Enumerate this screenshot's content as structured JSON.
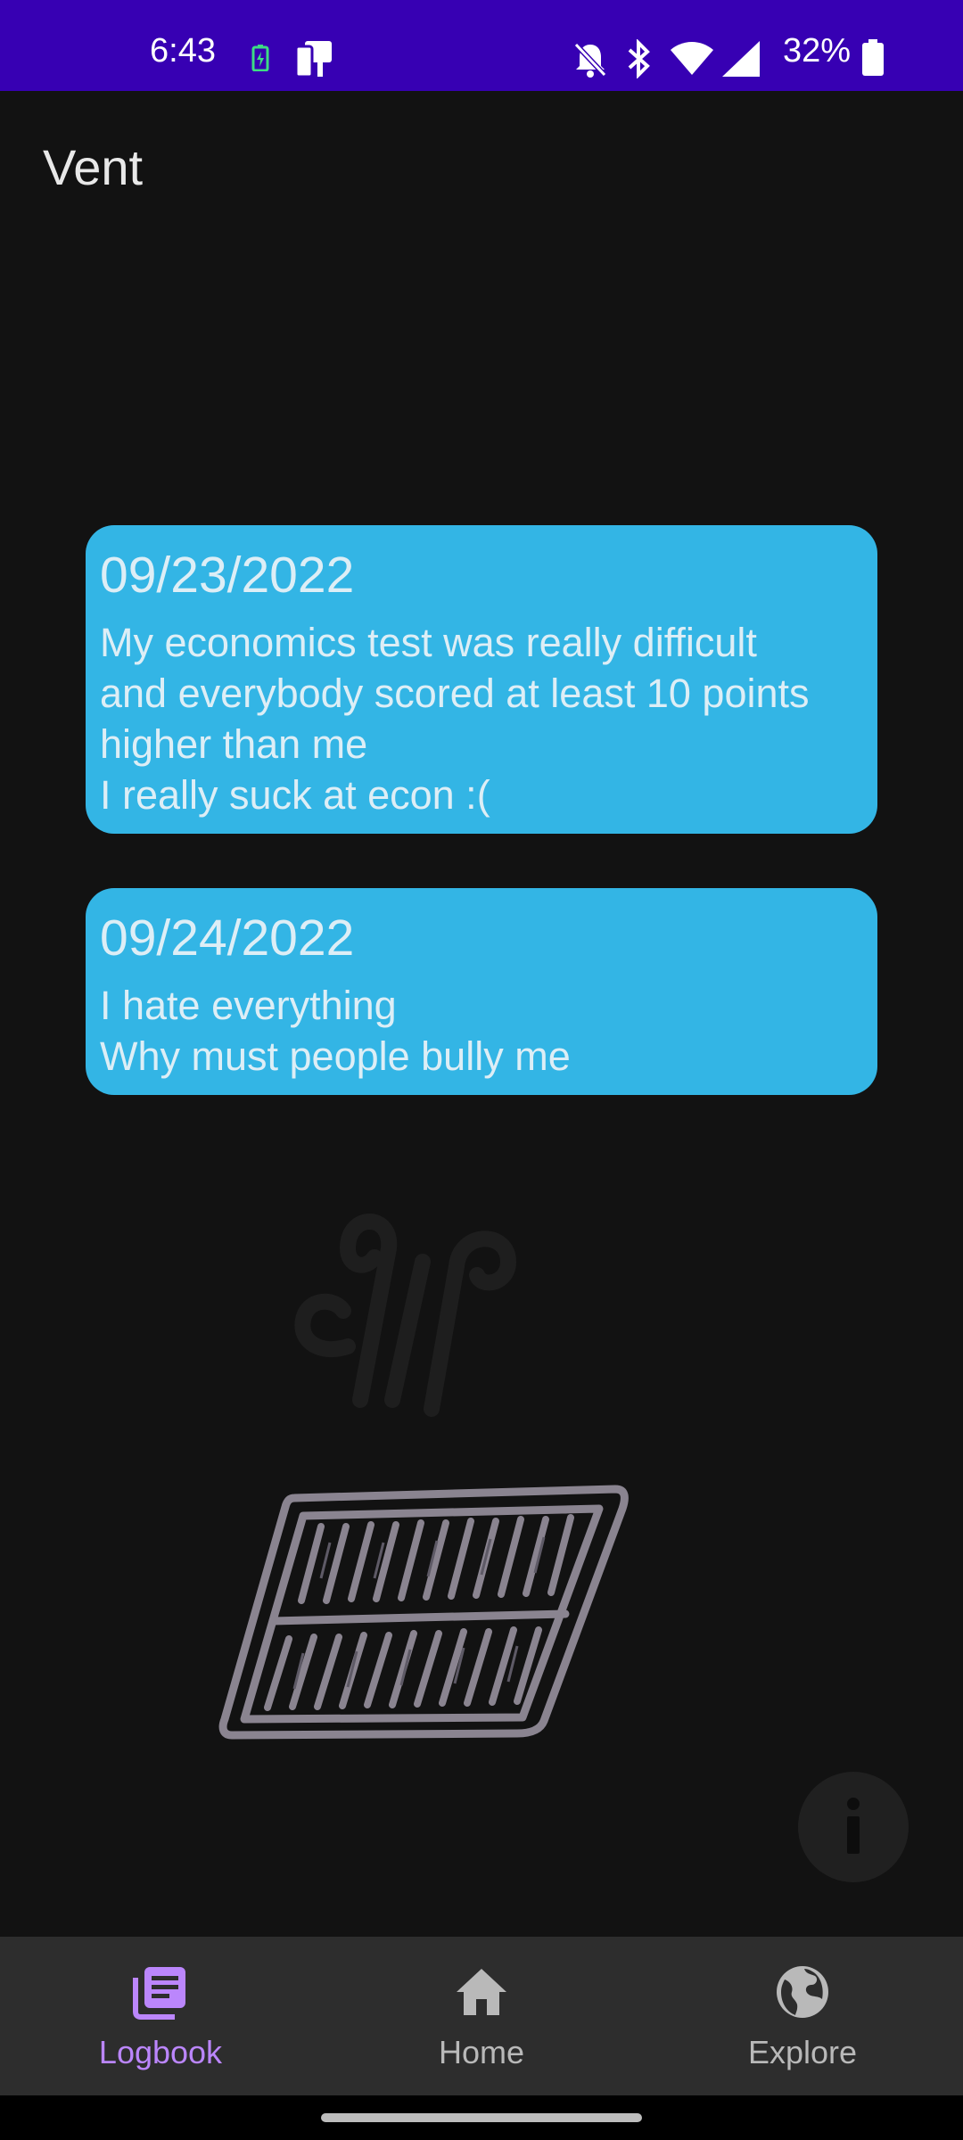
{
  "status_bar": {
    "time": "6:43",
    "battery_percent": "32%",
    "icons": [
      "battery-charging-icon",
      "cast-device-icon",
      "mute-bell-icon",
      "bluetooth-icon",
      "wifi-icon",
      "cell-signal-icon",
      "battery-icon"
    ],
    "background": "#3700b3"
  },
  "app_bar": {
    "title": "Vent"
  },
  "entries": [
    {
      "date": "09/23/2022",
      "text": "My economics test was really difficult\nand everybody scored at least 10 points\nhigher than me\nI really suck at econ :("
    },
    {
      "date": "09/24/2022",
      "text": "I hate everything\nWhy must people bully me"
    }
  ],
  "card_color": "#33b5e5",
  "illustration": "vent-grate-illustration",
  "fab": {
    "icon": "info-icon"
  },
  "bottom_nav": {
    "items": [
      {
        "label": "Logbook",
        "icon": "logbook-icon",
        "active": true
      },
      {
        "label": "Home",
        "icon": "home-icon",
        "active": false
      },
      {
        "label": "Explore",
        "icon": "globe-icon",
        "active": false
      }
    ],
    "active_color": "#bb86fc"
  }
}
